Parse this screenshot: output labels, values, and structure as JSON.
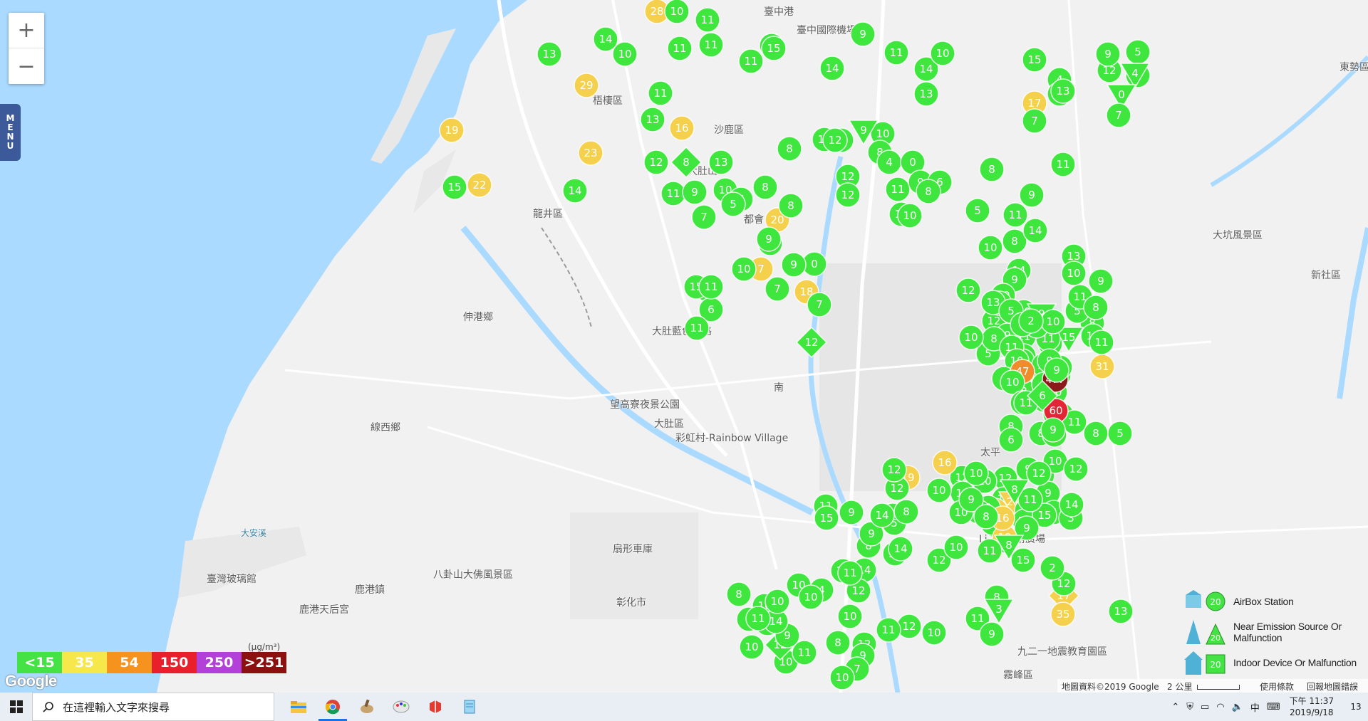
{
  "map": {
    "zoom_in_label": "+",
    "zoom_out_label": "−",
    "menu_label": "MENU",
    "places": [
      {
        "label": "臺中國際機場"
      },
      {
        "label": "梧棲區"
      },
      {
        "label": "沙鹿區"
      },
      {
        "label": "大肚山"
      },
      {
        "label": "龍井區"
      },
      {
        "label": "都會"
      },
      {
        "label": "大肚區"
      },
      {
        "label": "望高寮夜景公園"
      },
      {
        "label": "彩虹村-Rainbow Village"
      },
      {
        "label": "線西鄉"
      },
      {
        "label": "伸港鄉"
      },
      {
        "label": "鹿港鎮"
      },
      {
        "label": "臺灣玻璃館"
      },
      {
        "label": "八卦山大佛風景區"
      },
      {
        "label": "彰化市"
      },
      {
        "label": "扇形車庫"
      },
      {
        "label": "大坑風景區"
      },
      {
        "label": "新社區"
      },
      {
        "label": "東勢區"
      },
      {
        "label": "太平"
      },
      {
        "label": "Li Art藝術廣場"
      },
      {
        "label": "九二一地震教育園區"
      },
      {
        "label": "霧峰區"
      },
      {
        "label": "大肚藍色公路"
      },
      {
        "label": "鹿港天后宮"
      },
      {
        "label": "臺中港"
      },
      {
        "label": "大安溪"
      },
      {
        "label": "南"
      }
    ],
    "google_logo": "Google",
    "footer": {
      "attribution": "地圖資料©2019 Google",
      "scale": "2 公里",
      "terms": "使用條款",
      "report": "回報地圖錯誤"
    }
  },
  "legend": {
    "unit": "(μg/m³)",
    "scale": [
      {
        "label": "<15",
        "color": "#44e244"
      },
      {
        "label": "35",
        "color": "#f6e74b"
      },
      {
        "label": "54",
        "color": "#f5931e"
      },
      {
        "label": "150",
        "color": "#e8202c"
      },
      {
        "label": "250",
        "color": "#b340d8"
      },
      {
        "label": ">251",
        "color": "#8b1010"
      }
    ],
    "types": [
      {
        "label": "AirBox Station",
        "icon": "house-circle-icon"
      },
      {
        "label": "Near Emission Source Or Malfunction",
        "icon": "triangle-icon"
      },
      {
        "label": "Indoor Device Or Malfunction",
        "icon": "house-indoor-icon"
      }
    ]
  },
  "markers": [
    {
      "v": 28,
      "c": "yellow"
    },
    {
      "v": 10,
      "c": "green"
    },
    {
      "v": 11,
      "c": "green"
    },
    {
      "v": 13,
      "c": "green"
    },
    {
      "v": 14,
      "c": "green"
    },
    {
      "v": 10,
      "c": "green"
    },
    {
      "v": 11,
      "c": "green"
    },
    {
      "v": 11,
      "c": "green"
    },
    {
      "v": 15,
      "c": "green"
    },
    {
      "v": 11,
      "c": "green"
    },
    {
      "v": 29,
      "c": "yellow"
    },
    {
      "v": 11,
      "c": "green"
    },
    {
      "v": 13,
      "c": "green"
    },
    {
      "v": 16,
      "c": "yellow"
    },
    {
      "v": 19,
      "c": "yellow"
    },
    {
      "v": 23,
      "c": "yellow"
    },
    {
      "v": 12,
      "c": "green"
    },
    {
      "v": 8,
      "c": "green",
      "s": "diamond"
    },
    {
      "v": 13,
      "c": "green"
    },
    {
      "v": 15,
      "c": "green"
    },
    {
      "v": 22,
      "c": "yellow"
    },
    {
      "v": 15,
      "c": "green"
    },
    {
      "v": 14,
      "c": "green"
    },
    {
      "v": 11,
      "c": "green"
    },
    {
      "v": 9,
      "c": "green"
    },
    {
      "v": 10,
      "c": "green"
    },
    {
      "v": 8,
      "c": "green"
    },
    {
      "v": 6,
      "c": "green"
    },
    {
      "v": 5,
      "c": "green"
    },
    {
      "v": 7,
      "c": "green"
    },
    {
      "v": 3,
      "c": "green"
    },
    {
      "v": 11,
      "c": "green"
    },
    {
      "v": 8,
      "c": "green"
    },
    {
      "v": 9,
      "c": "green"
    },
    {
      "v": 20,
      "c": "yellow"
    },
    {
      "v": 8,
      "c": "green"
    },
    {
      "v": 9,
      "c": "green"
    },
    {
      "v": 7,
      "c": "yellow"
    },
    {
      "v": 10,
      "c": "green"
    },
    {
      "v": 0,
      "c": "green"
    },
    {
      "v": 13,
      "c": "green"
    },
    {
      "v": 6,
      "c": "green"
    },
    {
      "v": 11,
      "c": "green"
    },
    {
      "v": 18,
      "c": "yellow"
    },
    {
      "v": 7,
      "c": "green"
    },
    {
      "v": 15,
      "c": "green"
    },
    {
      "v": 11,
      "c": "green"
    },
    {
      "v": 12,
      "c": "green",
      "s": "diamond"
    },
    {
      "v": 9,
      "c": "green"
    },
    {
      "v": 7,
      "c": "green"
    },
    {
      "v": 14,
      "c": "green"
    },
    {
      "v": 13,
      "c": "green"
    },
    {
      "v": 11,
      "c": "green"
    },
    {
      "v": 10,
      "c": "green"
    },
    {
      "v": 9,
      "c": "green"
    },
    {
      "v": 14,
      "c": "green"
    },
    {
      "v": 10,
      "c": "green"
    },
    {
      "v": 9,
      "c": "green",
      "s": "triangle"
    },
    {
      "v": 12,
      "c": "green"
    },
    {
      "v": 8,
      "c": "green"
    },
    {
      "v": 4,
      "c": "green"
    },
    {
      "v": 0,
      "c": "green"
    },
    {
      "v": 12,
      "c": "green"
    },
    {
      "v": 12,
      "c": "green"
    },
    {
      "v": 11,
      "c": "green"
    },
    {
      "v": 9,
      "c": "green"
    },
    {
      "v": 6,
      "c": "green"
    },
    {
      "v": 10,
      "c": "green"
    },
    {
      "v": 8,
      "c": "green"
    },
    {
      "v": 10,
      "c": "green"
    },
    {
      "v": 8,
      "c": "green"
    },
    {
      "v": 5,
      "c": "green"
    },
    {
      "v": 15,
      "c": "green"
    },
    {
      "v": 4,
      "c": "green"
    },
    {
      "v": 9,
      "c": "green"
    },
    {
      "v": 12,
      "c": "green"
    },
    {
      "v": 13,
      "c": "green"
    },
    {
      "v": 17,
      "c": "yellow"
    },
    {
      "v": 9,
      "c": "green"
    },
    {
      "v": 5,
      "c": "green"
    },
    {
      "v": 9,
      "c": "green"
    },
    {
      "v": 4,
      "c": "green",
      "s": "triangle"
    },
    {
      "v": 0,
      "c": "green",
      "s": "triangle"
    },
    {
      "v": 7,
      "c": "green"
    },
    {
      "v": 11,
      "c": "green"
    },
    {
      "v": 7,
      "c": "green"
    },
    {
      "v": 9,
      "c": "green"
    },
    {
      "v": 8,
      "c": "green"
    },
    {
      "v": 11,
      "c": "green"
    },
    {
      "v": 10,
      "c": "green"
    },
    {
      "v": 13,
      "c": "green"
    },
    {
      "v": 10,
      "c": "green"
    },
    {
      "v": 9,
      "c": "green"
    },
    {
      "v": 14,
      "c": "green"
    },
    {
      "v": 14,
      "c": "green"
    },
    {
      "v": 9,
      "c": "green"
    },
    {
      "v": 10,
      "c": "green"
    },
    {
      "v": 12,
      "c": "green"
    },
    {
      "v": 10,
      "c": "green"
    },
    {
      "v": 11,
      "c": "green"
    },
    {
      "v": 10,
      "c": "green"
    },
    {
      "v": 6,
      "c": "green"
    },
    {
      "v": 5,
      "c": "green"
    },
    {
      "v": 10,
      "c": "green"
    },
    {
      "v": 9,
      "c": "green"
    },
    {
      "v": 4,
      "c": "green"
    },
    {
      "v": 8,
      "c": "green"
    },
    {
      "v": 8,
      "c": "green"
    },
    {
      "v": 11,
      "c": "green"
    },
    {
      "v": 8,
      "c": "green"
    },
    {
      "v": 5,
      "c": "green"
    },
    {
      "v": 11,
      "c": "green"
    },
    {
      "v": 8,
      "c": "green"
    },
    {
      "v": 15,
      "c": "green",
      "s": "triangle"
    },
    {
      "v": 11,
      "c": "green"
    },
    {
      "v": 13,
      "c": "green"
    },
    {
      "v": 14,
      "c": "green"
    },
    {
      "v": 10,
      "c": "green"
    },
    {
      "v": 8,
      "c": "green"
    },
    {
      "v": 11,
      "c": "green"
    },
    {
      "v": 13,
      "c": "green"
    },
    {
      "v": 12,
      "c": "green"
    },
    {
      "v": 10,
      "c": "green"
    },
    {
      "v": 5,
      "c": "green"
    },
    {
      "v": 9,
      "c": "green",
      "s": "triangle"
    },
    {
      "v": 12,
      "c": "green"
    },
    {
      "v": 11,
      "c": "green"
    },
    {
      "v": 7,
      "c": "green"
    },
    {
      "v": 6,
      "c": "green"
    },
    {
      "v": 8,
      "c": "green"
    },
    {
      "v": 10,
      "c": "green"
    },
    {
      "v": 2,
      "c": "green"
    },
    {
      "v": 10,
      "c": "green"
    },
    {
      "v": 9,
      "c": "green"
    },
    {
      "v": 10,
      "c": "green"
    },
    {
      "v": 6,
      "c": "green"
    },
    {
      "v": 8,
      "c": "green"
    },
    {
      "v": 477,
      "c": "maroon"
    },
    {
      "v": 47,
      "c": "orange"
    },
    {
      "v": 10,
      "c": "green"
    },
    {
      "v": 9,
      "c": "green"
    },
    {
      "v": 9,
      "c": "green"
    },
    {
      "v": 5,
      "c": "green"
    },
    {
      "v": 8,
      "c": "green"
    },
    {
      "v": 11,
      "c": "green"
    },
    {
      "v": 8,
      "c": "green"
    },
    {
      "v": 6,
      "c": "green"
    },
    {
      "v": 8,
      "c": "green"
    },
    {
      "v": 11,
      "c": "green"
    },
    {
      "v": 6,
      "c": "green"
    },
    {
      "v": 8,
      "c": "green"
    },
    {
      "v": 5,
      "c": "green"
    },
    {
      "v": 13,
      "c": "green"
    },
    {
      "v": 10,
      "c": "green"
    },
    {
      "v": 9,
      "c": "green"
    },
    {
      "v": 12,
      "c": "green"
    },
    {
      "v": 11,
      "c": "green"
    },
    {
      "v": 10,
      "c": "green"
    },
    {
      "v": 4,
      "c": "green"
    },
    {
      "v": 10,
      "c": "green"
    },
    {
      "v": 8,
      "c": "green"
    },
    {
      "v": 21,
      "c": "yellow",
      "s": "triangle"
    },
    {
      "v": 13,
      "c": "green"
    },
    {
      "v": 9,
      "c": "green"
    },
    {
      "v": 4,
      "c": "green"
    },
    {
      "v": 3,
      "c": "green"
    },
    {
      "v": 14,
      "c": "green"
    },
    {
      "v": 10,
      "c": "green"
    },
    {
      "v": 18,
      "c": "yellow"
    },
    {
      "v": 10,
      "c": "green"
    },
    {
      "v": 15,
      "c": "green"
    },
    {
      "v": 9,
      "c": "green"
    },
    {
      "v": 11,
      "c": "green"
    },
    {
      "v": 8,
      "c": "green",
      "s": "triangle"
    },
    {
      "v": 9,
      "c": "green"
    },
    {
      "v": 12,
      "c": "green"
    },
    {
      "v": 31,
      "c": "yellow"
    },
    {
      "v": 60,
      "c": "red"
    },
    {
      "v": 9,
      "c": "green"
    },
    {
      "v": 6,
      "c": "green",
      "s": "diamond"
    },
    {
      "v": 11,
      "c": "green"
    },
    {
      "v": 12,
      "c": "green"
    },
    {
      "v": 11,
      "c": "green"
    },
    {
      "v": 14,
      "c": "green"
    },
    {
      "v": 19,
      "c": "yellow"
    },
    {
      "v": 16,
      "c": "yellow"
    },
    {
      "v": 12,
      "c": "green"
    },
    {
      "v": 12,
      "c": "green"
    },
    {
      "v": 12,
      "c": "green"
    },
    {
      "v": 10,
      "c": "green"
    },
    {
      "v": 10,
      "c": "green"
    },
    {
      "v": 9,
      "c": "green"
    },
    {
      "v": 16,
      "c": "yellow"
    },
    {
      "v": 10,
      "c": "green"
    },
    {
      "v": 19,
      "c": "yellow"
    },
    {
      "v": 12,
      "c": "green"
    },
    {
      "v": 6,
      "c": "green"
    },
    {
      "v": 5,
      "c": "green"
    },
    {
      "v": 8,
      "c": "green"
    },
    {
      "v": 9,
      "c": "green"
    },
    {
      "v": 8,
      "c": "green"
    },
    {
      "v": 10,
      "c": "green"
    },
    {
      "v": 12,
      "c": "green"
    },
    {
      "v": 11,
      "c": "green"
    },
    {
      "v": 15,
      "c": "green"
    },
    {
      "v": 10,
      "c": "green"
    },
    {
      "v": 9,
      "c": "green"
    },
    {
      "v": 14,
      "c": "green"
    },
    {
      "v": 14,
      "c": "green"
    },
    {
      "v": 14,
      "c": "green"
    },
    {
      "v": 10,
      "c": "green"
    },
    {
      "v": 12,
      "c": "green"
    },
    {
      "v": 10,
      "c": "green"
    },
    {
      "v": 11,
      "c": "green"
    },
    {
      "v": 8,
      "c": "green"
    },
    {
      "v": 15,
      "c": "green"
    },
    {
      "v": 8,
      "c": "green"
    },
    {
      "v": 3,
      "c": "green",
      "s": "triangle"
    },
    {
      "v": 17,
      "c": "yellow",
      "s": "diamond"
    },
    {
      "v": 35,
      "c": "yellow"
    },
    {
      "v": 13,
      "c": "green"
    },
    {
      "v": 12,
      "c": "green"
    },
    {
      "v": 2,
      "c": "green"
    },
    {
      "v": 8,
      "c": "green",
      "s": "triangle"
    },
    {
      "v": 11,
      "c": "green"
    },
    {
      "v": 9,
      "c": "green"
    },
    {
      "v": 10,
      "c": "green"
    },
    {
      "v": 12,
      "c": "green"
    },
    {
      "v": 11,
      "c": "green"
    },
    {
      "v": 12,
      "c": "green"
    },
    {
      "v": 9,
      "c": "green"
    },
    {
      "v": 8,
      "c": "green"
    },
    {
      "v": 7,
      "c": "green"
    },
    {
      "v": 10,
      "c": "green"
    },
    {
      "v": 10,
      "c": "green"
    },
    {
      "v": 8,
      "c": "green"
    },
    {
      "v": 10,
      "c": "green"
    },
    {
      "v": 11,
      "c": "green"
    },
    {
      "v": 12,
      "c": "green",
      "s": "diamond"
    },
    {
      "v": 9,
      "c": "green"
    },
    {
      "v": 12,
      "c": "green"
    },
    {
      "v": 11,
      "c": "green"
    },
    {
      "v": 4,
      "c": "green"
    },
    {
      "v": 10,
      "c": "green"
    },
    {
      "v": 10,
      "c": "green"
    },
    {
      "v": 9,
      "c": "green"
    },
    {
      "v": 10,
      "c": "green"
    },
    {
      "v": 11,
      "c": "green"
    },
    {
      "v": 14,
      "c": "green"
    },
    {
      "v": 10,
      "c": "green"
    },
    {
      "v": 11,
      "c": "green"
    }
  ],
  "taskbar": {
    "search_placeholder": "在這裡輸入文字來搜尋",
    "apps": [
      "file-explorer-icon",
      "chrome-icon",
      "paint-icon",
      "palette-icon",
      "sketchup-icon",
      "notepad-icon"
    ],
    "tray_ime": "中",
    "time": "下午 11:37",
    "date": "2019/9/18",
    "notifications": "13"
  }
}
